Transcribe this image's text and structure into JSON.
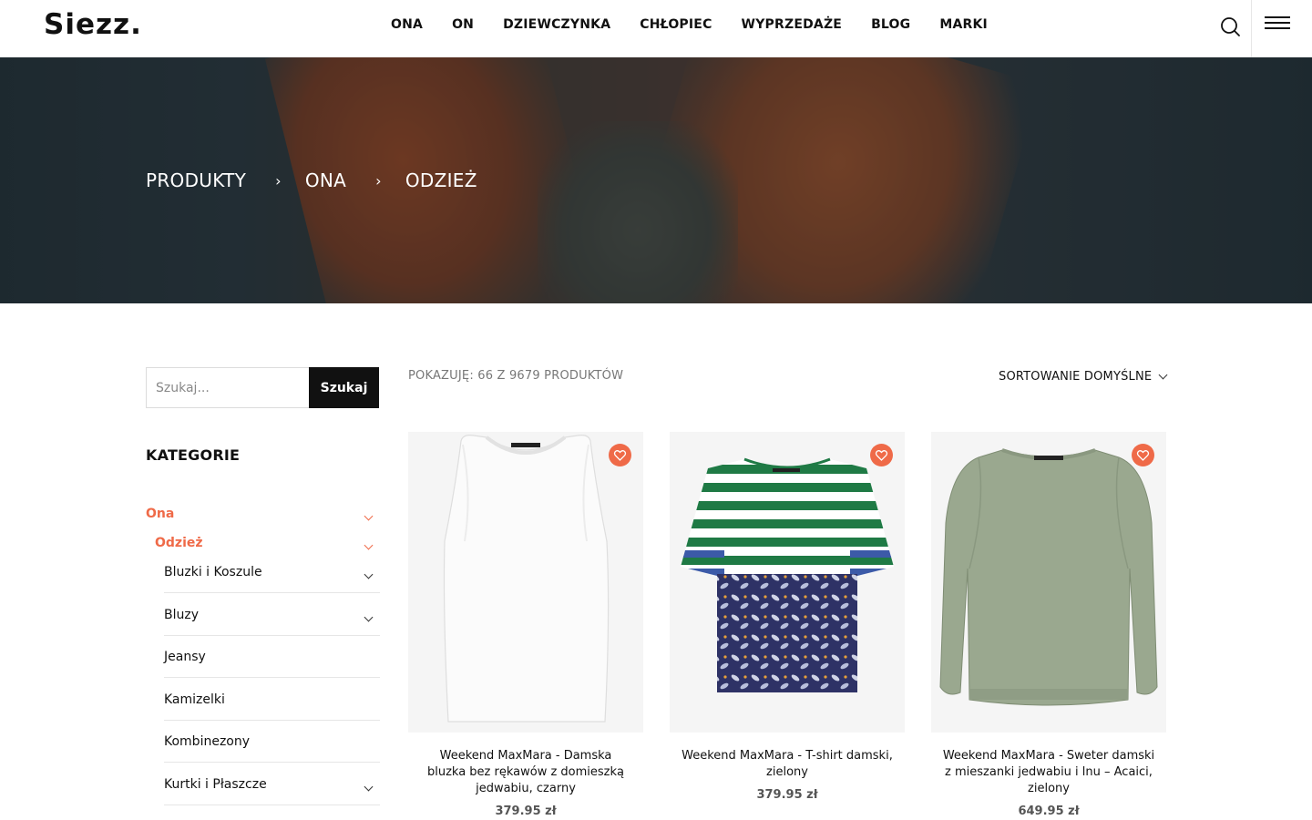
{
  "header": {
    "logo": "Siezz.",
    "nav": [
      "ONA",
      "ON",
      "DZIEWCZYNKA",
      "CHŁOPIEC",
      "WYPRZEDAŻE",
      "BLOG",
      "MARKI"
    ]
  },
  "hero": {
    "breadcrumb": [
      "PRODUKTY",
      "ONA",
      "ODZIEŻ"
    ],
    "separator": "›"
  },
  "sidebar": {
    "search": {
      "placeholder": "Szukaj...",
      "button": "Szukaj"
    },
    "title": "KATEGORIE",
    "categories": [
      {
        "label": "Ona",
        "expandable": true,
        "active": true
      },
      {
        "label": "Odzież",
        "expandable": true,
        "active": true
      },
      {
        "label": "Bluzki i Koszule",
        "expandable": true
      },
      {
        "label": "Bluzy",
        "expandable": true
      },
      {
        "label": "Jeansy",
        "expandable": false
      },
      {
        "label": "Kamizelki",
        "expandable": false
      },
      {
        "label": "Kombinezony",
        "expandable": false
      },
      {
        "label": "Kurtki i Płaszcze",
        "expandable": true
      }
    ]
  },
  "toolbar": {
    "result_count": "POKAZUJĘ: 66 Z 9679 PRODUKTÓW",
    "sort": "SORTOWANIE DOMYŚLNE"
  },
  "products": [
    {
      "name": "Weekend MaxMara - Damska bluzka bez rękawów z domieszką jedwabiu, czarny",
      "price": "379.95 zł"
    },
    {
      "name": "Weekend MaxMara - T-shirt damski, zielony",
      "price": "379.95 zł"
    },
    {
      "name": "Weekend MaxMara - Sweter damski z mieszanki jedwabiu i lnu – Acaici, zielony",
      "price": "649.95 zł"
    }
  ],
  "colors": {
    "accent": "#ef6a48",
    "text": "#111111",
    "muted": "#777777"
  },
  "icons": {
    "search": "search-icon",
    "menu": "hamburger-menu-icon",
    "wishlist": "heart-icon",
    "expand": "chevron-down-icon"
  }
}
